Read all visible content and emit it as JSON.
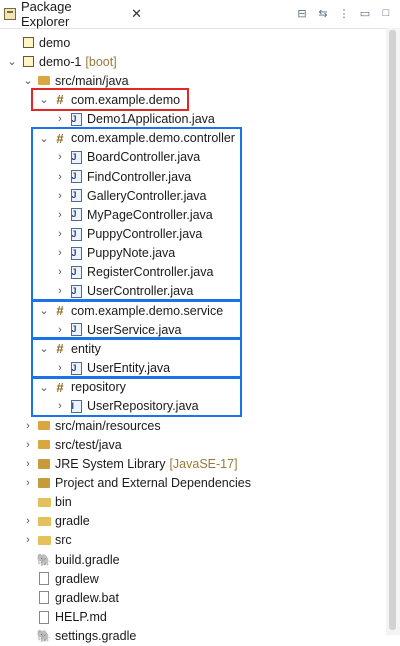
{
  "view": {
    "title": "Package Explorer",
    "close_glyph": "✕",
    "toolbar": [
      {
        "name": "collapse-all-icon",
        "glyph": "⊟"
      },
      {
        "name": "link-editor-icon",
        "glyph": "⇆"
      },
      {
        "name": "view-menu-icon",
        "glyph": "⋮"
      },
      {
        "name": "minimize-icon",
        "glyph": "▭"
      },
      {
        "name": "maximize-icon",
        "glyph": "□"
      }
    ]
  },
  "tree": [
    {
      "label": "demo",
      "tw": "",
      "icon": "project-icon",
      "kind": "proj"
    },
    {
      "label": "demo-1",
      "decoration": "[boot]",
      "tw": "⌄",
      "icon": "project-icon",
      "kind": "proj"
    },
    {
      "label": "src/main/java",
      "tw": "⌄",
      "icon": "source-folder-icon",
      "kind": "pkgroot"
    },
    {
      "label": "com.example.demo",
      "tw": "⌄",
      "icon": "package-icon",
      "kind": "pkg"
    },
    {
      "label": "Demo1Application.java",
      "tw": "›",
      "icon": "java-file-icon",
      "kind": "java"
    },
    {
      "label": "com.example.demo.controller",
      "tw": "⌄",
      "icon": "package-icon",
      "kind": "pkg"
    },
    {
      "label": "BoardController.java",
      "tw": "›",
      "icon": "java-file-icon",
      "kind": "java"
    },
    {
      "label": "FindController.java",
      "tw": "›",
      "icon": "java-file-icon",
      "kind": "java"
    },
    {
      "label": "GalleryController.java",
      "tw": "›",
      "icon": "java-file-icon",
      "kind": "java"
    },
    {
      "label": "MyPageController.java",
      "tw": "›",
      "icon": "java-file-icon",
      "kind": "java"
    },
    {
      "label": "PuppyController.java",
      "tw": "›",
      "icon": "java-file-icon",
      "kind": "java"
    },
    {
      "label": "PuppyNote.java",
      "tw": "›",
      "icon": "java-file-icon",
      "kind": "java"
    },
    {
      "label": "RegisterController.java",
      "tw": "›",
      "icon": "java-file-icon",
      "kind": "java"
    },
    {
      "label": "UserController.java",
      "tw": "›",
      "icon": "java-file-icon",
      "kind": "java"
    },
    {
      "label": "com.example.demo.service",
      "tw": "⌄",
      "icon": "package-icon",
      "kind": "pkg"
    },
    {
      "label": "UserService.java",
      "tw": "›",
      "icon": "java-file-icon",
      "kind": "java"
    },
    {
      "label": "entity",
      "tw": "⌄",
      "icon": "package-icon",
      "kind": "pkg"
    },
    {
      "label": "UserEntity.java",
      "tw": "›",
      "icon": "java-file-icon",
      "kind": "java"
    },
    {
      "label": "repository",
      "tw": "⌄",
      "icon": "package-icon",
      "kind": "pkg"
    },
    {
      "label": "UserRepository.java",
      "tw": "›",
      "icon": "java-interface-icon",
      "kind": "java"
    },
    {
      "label": "src/main/resources",
      "tw": "›",
      "icon": "source-folder-icon",
      "kind": "pkgroot"
    },
    {
      "label": "src/test/java",
      "tw": "›",
      "icon": "source-folder-icon",
      "kind": "pkgroot"
    },
    {
      "label": "JRE System Library",
      "decoration": "[JavaSE-17]",
      "tw": "›",
      "icon": "library-icon",
      "kind": "lib"
    },
    {
      "label": "Project and External Dependencies",
      "tw": "›",
      "icon": "library-icon",
      "kind": "lib"
    },
    {
      "label": "bin",
      "tw": "",
      "icon": "folder-icon",
      "kind": "folder"
    },
    {
      "label": "gradle",
      "tw": "›",
      "icon": "folder-icon",
      "kind": "folder"
    },
    {
      "label": "src",
      "tw": "›",
      "icon": "folder-icon",
      "kind": "folder"
    },
    {
      "label": "build.gradle",
      "tw": "",
      "icon": "gradle-file-icon",
      "kind": "gradle"
    },
    {
      "label": "gradlew",
      "tw": "",
      "icon": "file-icon",
      "kind": "file"
    },
    {
      "label": "gradlew.bat",
      "tw": "",
      "icon": "file-icon",
      "kind": "file"
    },
    {
      "label": "HELP.md",
      "tw": "",
      "icon": "markdown-file-icon",
      "kind": "file"
    },
    {
      "label": "settings.gradle",
      "tw": "",
      "icon": "gradle-file-icon",
      "kind": "gradle"
    }
  ],
  "highlights": [
    {
      "name": "highlight-com-example-demo",
      "color": "#e32727",
      "from": 3,
      "to": 3
    },
    {
      "name": "highlight-controller-package",
      "color": "#1a73e8",
      "from": 5,
      "to": 13
    },
    {
      "name": "highlight-service-package",
      "color": "#1a73e8",
      "from": 14,
      "to": 15
    },
    {
      "name": "highlight-entity-package",
      "color": "#1a73e8",
      "from": 16,
      "to": 17
    },
    {
      "name": "highlight-repository-package",
      "color": "#1a73e8",
      "from": 18,
      "to": 19
    }
  ]
}
